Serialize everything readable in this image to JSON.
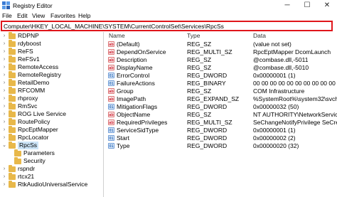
{
  "window": {
    "title": "Registry Editor"
  },
  "window_controls": {
    "minimize": "─",
    "maximize": "☐",
    "close": "✕"
  },
  "menu": [
    "File",
    "Edit",
    "View",
    "Favorites",
    "Help"
  ],
  "address": {
    "path": "Computer\\HKEY_LOCAL_MACHINE\\SYSTEM\\CurrentControlSet\\Services\\RpcSs"
  },
  "tree": [
    {
      "label": "RDPNP",
      "chevron": "›"
    },
    {
      "label": "rdyboost",
      "chevron": "›"
    },
    {
      "label": "ReFS",
      "chevron": "›"
    },
    {
      "label": "ReFSv1",
      "chevron": "›"
    },
    {
      "label": "RemoteAccess",
      "chevron": "›"
    },
    {
      "label": "RemoteRegistry",
      "chevron": "›"
    },
    {
      "label": "RetailDemo",
      "chevron": "›"
    },
    {
      "label": "RFCOMM",
      "chevron": "›"
    },
    {
      "label": "rhproxy",
      "chevron": "›"
    },
    {
      "label": "RmSvc",
      "chevron": "›"
    },
    {
      "label": "ROG Live Service",
      "chevron": "›"
    },
    {
      "label": "RoutePolicy",
      "chevron": "›"
    },
    {
      "label": "RpcEptMapper",
      "chevron": "›"
    },
    {
      "label": "RpcLocator",
      "chevron": "›"
    },
    {
      "label": "RpcSs",
      "chevron": "⌄",
      "selected": true
    },
    {
      "label": "Parameters",
      "chevron": "",
      "child": true
    },
    {
      "label": "Security",
      "chevron": "",
      "child": true
    },
    {
      "label": "rspndr",
      "chevron": "›"
    },
    {
      "label": "rtcx21",
      "chevron": "›"
    },
    {
      "label": "RtkAudioUniversalService",
      "chevron": "›"
    }
  ],
  "columns": {
    "name": "Name",
    "type": "Type",
    "data": "Data"
  },
  "values": [
    {
      "icon": "ab",
      "kind": "sz",
      "name": "(Default)",
      "type": "REG_SZ",
      "data": "(value not set)"
    },
    {
      "icon": "ab",
      "kind": "sz",
      "name": "DependOnService",
      "type": "REG_MULTI_SZ",
      "data": "RpcEptMapper DcomLaunch"
    },
    {
      "icon": "ab",
      "kind": "sz",
      "name": "Description",
      "type": "REG_SZ",
      "data": "@combase.dll,-5011"
    },
    {
      "icon": "ab",
      "kind": "sz",
      "name": "DisplayName",
      "type": "REG_SZ",
      "data": "@combase.dll,-5010"
    },
    {
      "icon": "01",
      "kind": "bin",
      "name": "ErrorControl",
      "type": "REG_DWORD",
      "data": "0x00000001 (1)"
    },
    {
      "icon": "01",
      "kind": "bin",
      "name": "FailureActions",
      "type": "REG_BINARY",
      "data": "00 00 00 00 00 00 00 00 00 00"
    },
    {
      "icon": "ab",
      "kind": "sz",
      "name": "Group",
      "type": "REG_SZ",
      "data": "COM Infrastructure"
    },
    {
      "icon": "ab",
      "kind": "sz",
      "name": "ImagePath",
      "type": "REG_EXPAND_SZ",
      "data": "%SystemRoot%\\system32\\svchost.exe"
    },
    {
      "icon": "01",
      "kind": "bin",
      "name": "MitigationFlags",
      "type": "REG_DWORD",
      "data": "0x00000032 (50)"
    },
    {
      "icon": "ab",
      "kind": "sz",
      "name": "ObjectName",
      "type": "REG_SZ",
      "data": "NT AUTHORITY\\NetworkService"
    },
    {
      "icon": "ab",
      "kind": "sz",
      "name": "RequiredPrivileges",
      "type": "REG_MULTI_SZ",
      "data": "SeChangeNotifyPrivilege SeCreateG"
    },
    {
      "icon": "01",
      "kind": "bin",
      "name": "ServiceSidType",
      "type": "REG_DWORD",
      "data": "0x00000001 (1)"
    },
    {
      "icon": "01",
      "kind": "bin",
      "name": "Start",
      "type": "REG_DWORD",
      "data": "0x00000002 (2)"
    },
    {
      "icon": "01",
      "kind": "bin",
      "name": "Type",
      "type": "REG_DWORD",
      "data": "0x00000020 (32)"
    }
  ]
}
